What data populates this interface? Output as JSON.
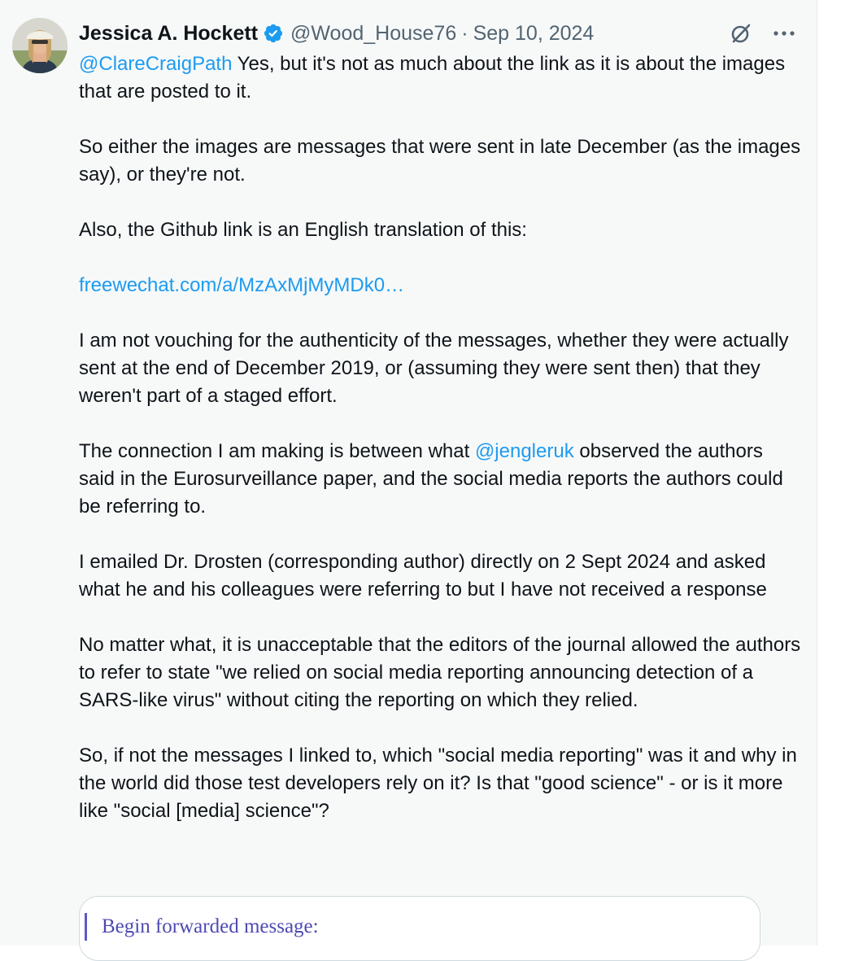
{
  "author": {
    "name": "Jessica A. Hockett",
    "handle": "@Wood_House76",
    "separator": "·",
    "date": "Sep 10, 2024",
    "verified": true
  },
  "icons": {
    "verified": "verified-badge-icon",
    "grok": "grok-icon",
    "more": "more-icon"
  },
  "colors": {
    "link": "#1d9bf0",
    "verified": "#1d9bf0",
    "secondary_text": "#536471",
    "background": "#f7f9f9",
    "quote_bar": "#5e5ac6"
  },
  "tweet": {
    "p1": {
      "mention": "@ClareCraigPath",
      "text": " Yes, but it's not as much about the link as it is about the images that are posted to it."
    },
    "p2": "So either the images are messages that were sent in late December (as the images say), or they're not.",
    "p3": "Also, the Github link is an English translation of this:",
    "p4_link": "freewechat.com/a/MzAxMjMyMDk0…",
    "p5": "I am not vouching for the authenticity of the messages, whether they were actually sent at the end of December 2019, or (assuming they were sent then) that they weren't part of a staged effort.",
    "p6": {
      "before": "The connection I am making is between what ",
      "mention": "@jengleruk",
      "after": " observed the authors said in the Eurosurveillance paper, and the social media reports the authors could be referring to."
    },
    "p7": "I emailed Dr. Drosten (corresponding author) directly on 2 Sept 2024 and asked what he and his colleagues were referring to but I have not received a response",
    "p8": "No matter what, it is unacceptable that the editors of the journal allowed the authors to refer to state \"we relied on social media reporting announcing detection of a SARS-like virus\" without citing the reporting on which they relied.",
    "p9": "So, if not the messages I linked to, which \"social media reporting\" was it and why in the world did those test developers rely on it? Is that \"good science\" - or is it more like \"social [media] science\"?"
  },
  "media": {
    "forwarded_label": "Begin forwarded message:"
  }
}
